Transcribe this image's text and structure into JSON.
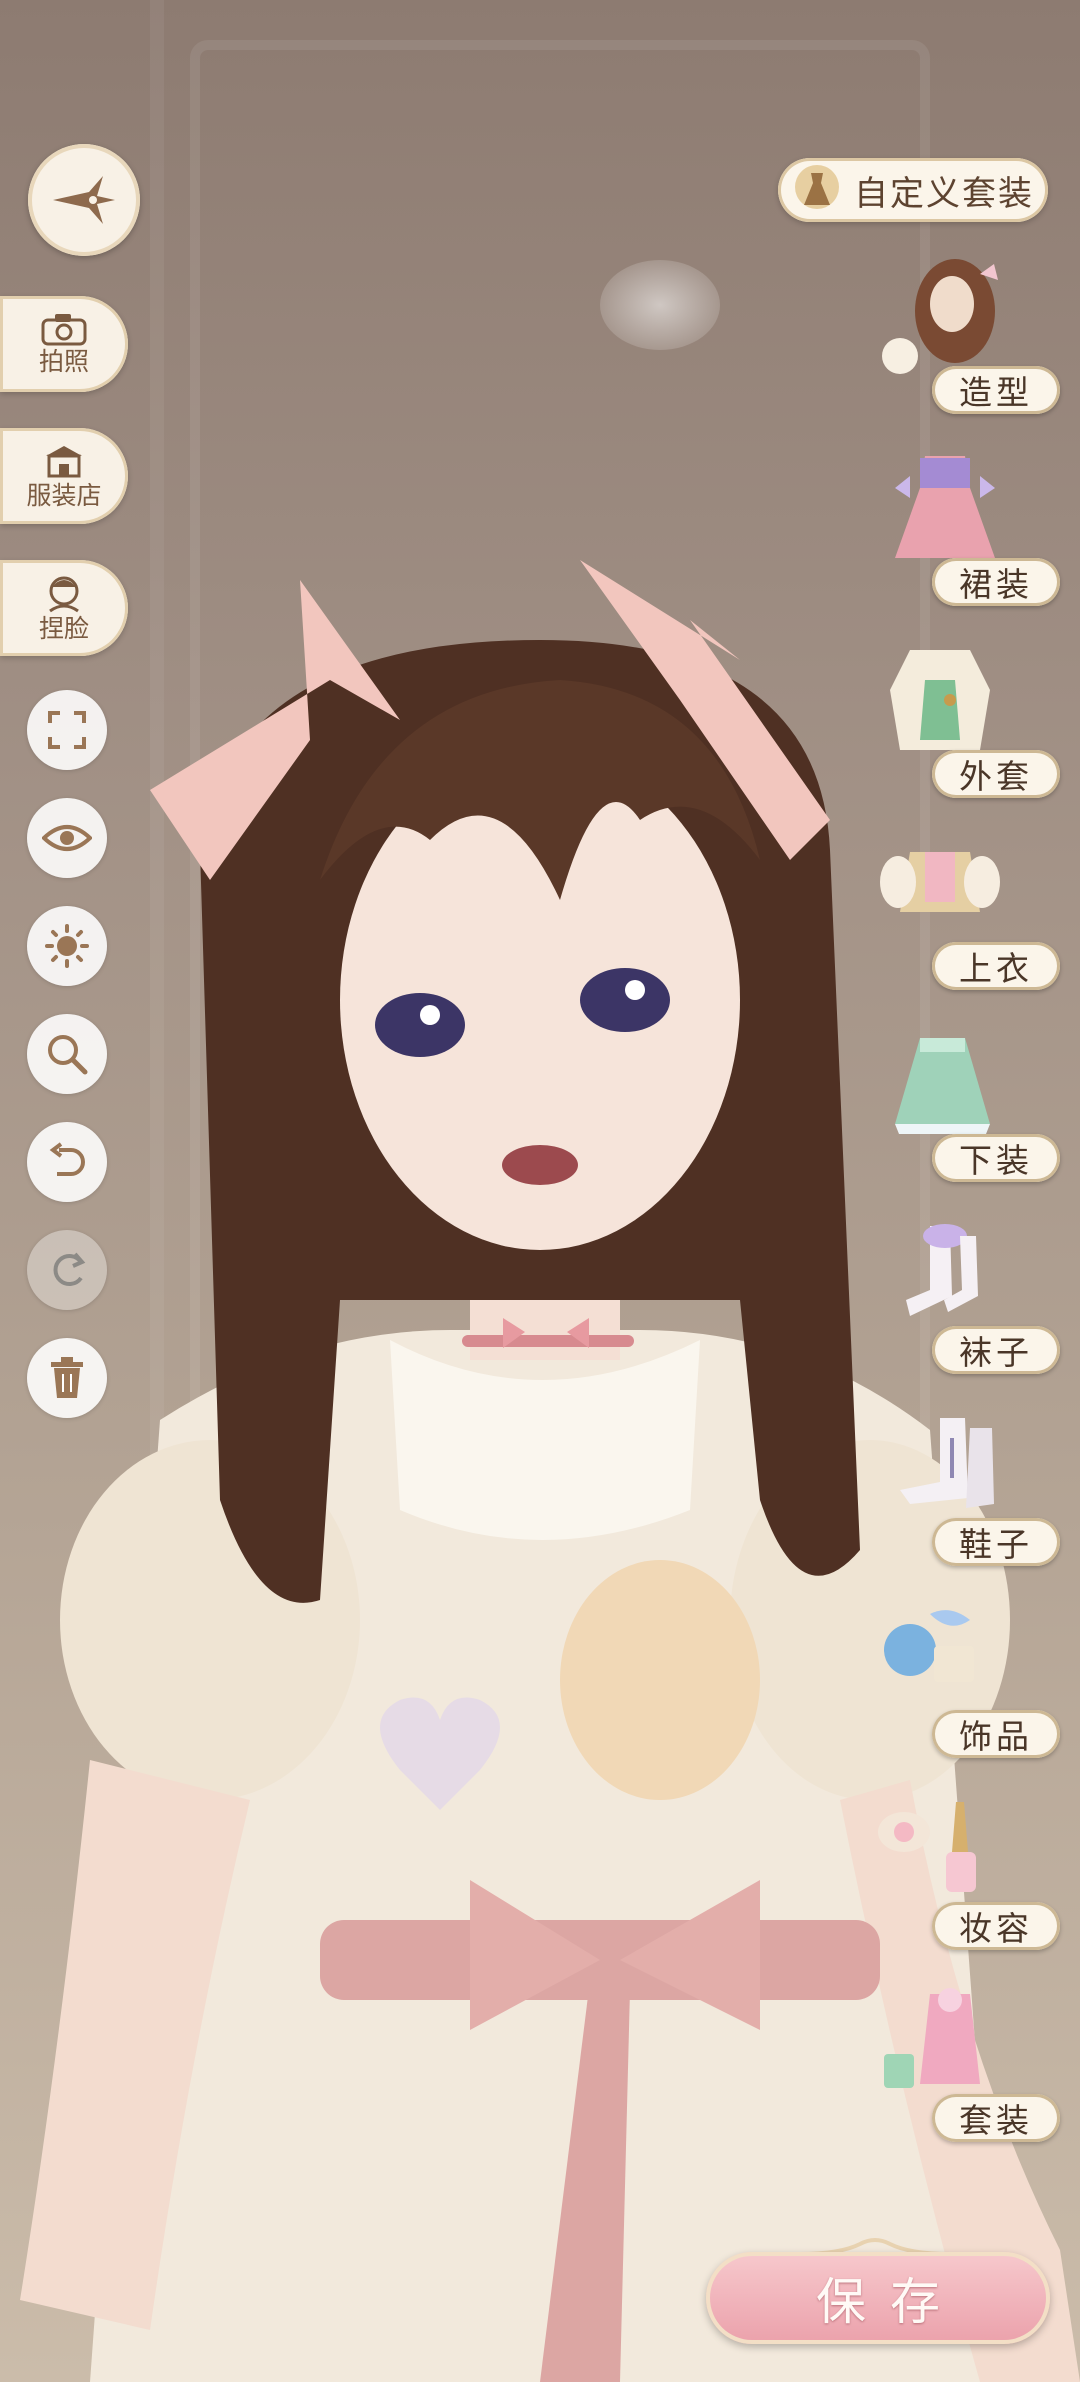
{
  "left_menu": {
    "photo_label": "拍照",
    "shop_label": "服装店",
    "face_label": "捏脸"
  },
  "toolbar": {
    "fullscreen_icon": "fullscreen-icon",
    "hide_icon": "eye-icon",
    "light_icon": "sun-icon",
    "zoom_icon": "magnifier-icon",
    "undo_icon": "undo-icon",
    "redo_icon": "redo-icon",
    "delete_icon": "trash-icon"
  },
  "custom_outfit": {
    "label": "自定义套装"
  },
  "categories": [
    {
      "label": "造型"
    },
    {
      "label": "裙装"
    },
    {
      "label": "外套"
    },
    {
      "label": "上衣"
    },
    {
      "label": "下装"
    },
    {
      "label": "袜子"
    },
    {
      "label": "鞋子"
    },
    {
      "label": "饰品"
    },
    {
      "label": "妆容"
    },
    {
      "label": "套装"
    }
  ],
  "save": {
    "label": "保存"
  },
  "colors": {
    "panel_bg": "#f8f1e6",
    "accent_gold": "#dcc7a3",
    "text_brown": "#5d4330",
    "save_pink": "#eba1ab"
  }
}
